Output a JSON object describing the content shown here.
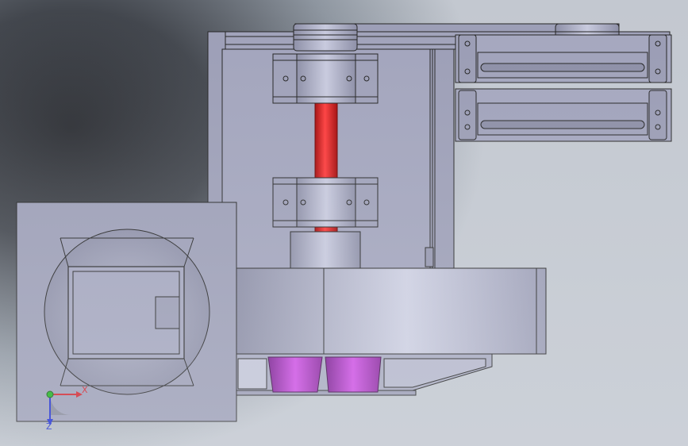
{
  "view": {
    "background_colors": [
      "#2a2c31",
      "#8e96a0",
      "#c3c8d0"
    ],
    "part_color": "#9a9cb4",
    "shaft_color": "#d41414",
    "blade_color": "#b43cc8"
  },
  "triad": {
    "x_label": "X",
    "z_label": "Z",
    "x_color": "#d0202a",
    "y_color": "#18b018",
    "z_color": "#1a2ad0"
  }
}
